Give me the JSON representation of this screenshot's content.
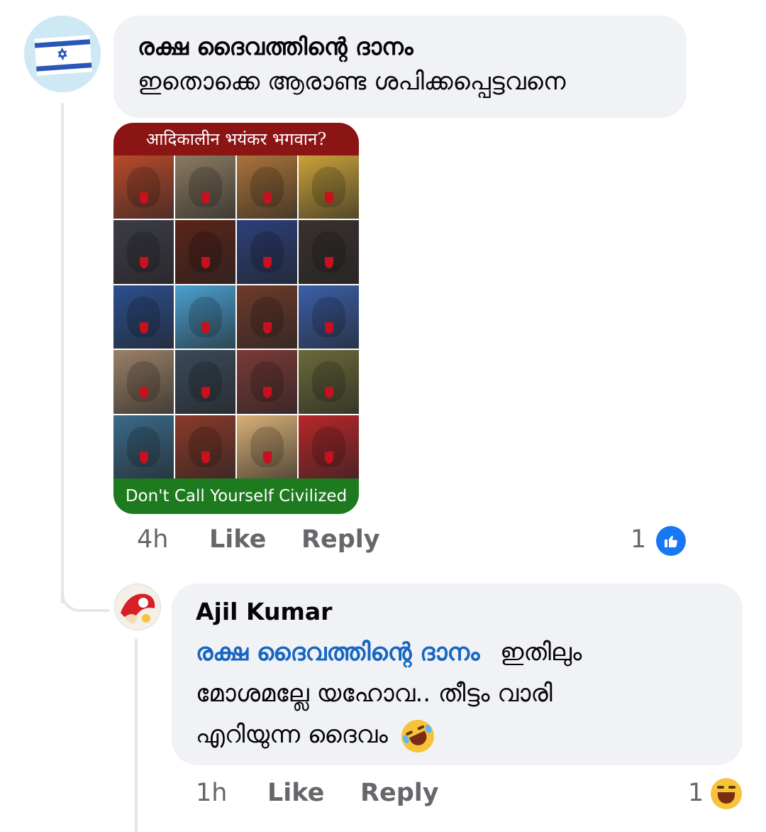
{
  "colors": {
    "bubble_bg": "#f0f2f5",
    "mention": "#1766c2",
    "muted": "#65676b",
    "like_blue": "#1877f2",
    "thread_line": "#e4e6eb"
  },
  "comment": {
    "author": "രക്ഷ ദൈവത്തിന്റെ ദാനം",
    "text": "ഇതൊക്കെ ആരാണ്ട ശപിക്കപ്പെട്ടവനെ",
    "avatar_icon": "israel-flag-avatar",
    "attachment": {
      "top_caption": "आदिकालीन भयंकर भगवान?",
      "bottom_caption": "Don't Call Yourself Civilized",
      "tile_colors": [
        "#b84a2c",
        "#8a7a62",
        "#a9733a",
        "#c9a23a",
        "#3c3c48",
        "#5a2418",
        "#2c3f7a",
        "#3a3030",
        "#2b4f8e",
        "#4a9fd0",
        "#6e3a2a",
        "#3b5fa8",
        "#9a8068",
        "#3a4a5a",
        "#7a3a38",
        "#6a6a3a",
        "#3a6a8a",
        "#8a3a2a",
        "#d8b078",
        "#b8262a"
      ]
    },
    "time": "4h",
    "like_label": "Like",
    "reply_label": "Reply",
    "reaction_count": "1",
    "reaction_icon": "like-reaction-icon"
  },
  "reply": {
    "author": "Ajil Kumar",
    "mention": "രക്ഷ ദൈവത്തിന്റെ ദാനം",
    "line1_rest": "ഇതിലും",
    "line2": "മോശമല്ലേ യഹോവ.. തീട്ടം വാരി",
    "line3": "എറിയുന്ന ദൈവം",
    "emoji": "rolling-on-floor-laughing-emoji",
    "avatar_icon": "cartoon-avatar",
    "time": "1h",
    "like_label": "Like",
    "reply_label": "Reply",
    "reaction_count": "1",
    "reaction_icon": "haha-reaction-icon"
  }
}
